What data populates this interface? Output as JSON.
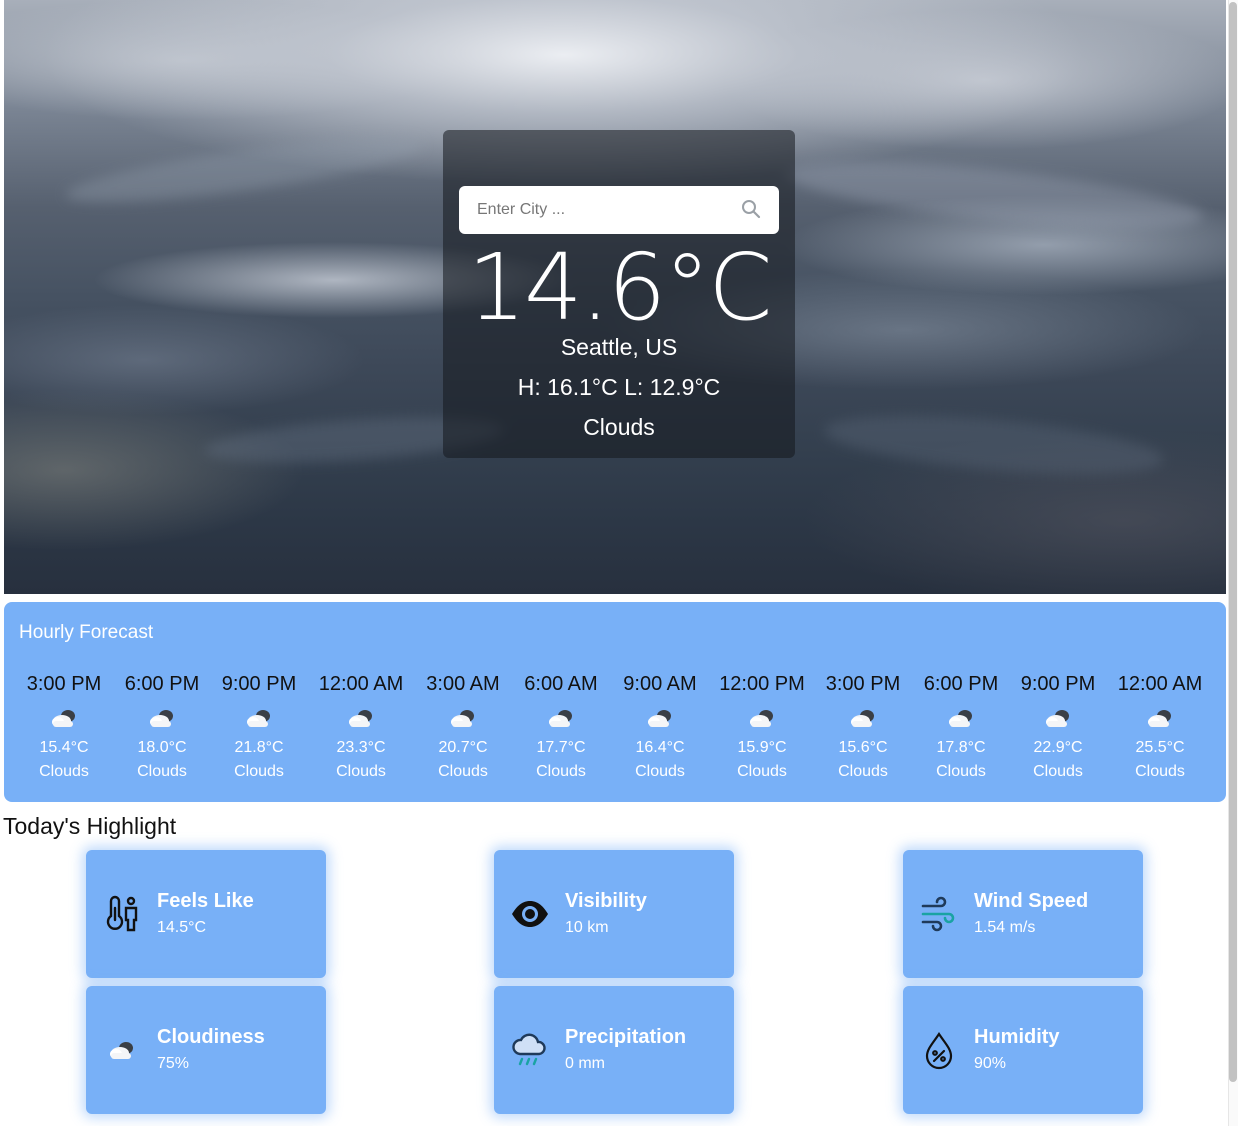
{
  "search": {
    "placeholder": "Enter City ..."
  },
  "current": {
    "temperature": "14.6°C",
    "location": "Seattle, US",
    "high_low": "H: 16.1°C L: 12.9°C",
    "condition": "Clouds"
  },
  "hourly": {
    "title": "Hourly Forecast",
    "items": [
      {
        "time": "3:00 PM",
        "temp": "15.4°C",
        "desc": "Clouds",
        "icon": "cloud-icon"
      },
      {
        "time": "6:00 PM",
        "temp": "18.0°C",
        "desc": "Clouds",
        "icon": "cloud-icon"
      },
      {
        "time": "9:00 PM",
        "temp": "21.8°C",
        "desc": "Clouds",
        "icon": "cloud-icon"
      },
      {
        "time": "12:00 AM",
        "temp": "23.3°C",
        "desc": "Clouds",
        "icon": "cloud-icon"
      },
      {
        "time": "3:00 AM",
        "temp": "20.7°C",
        "desc": "Clouds",
        "icon": "cloud-icon"
      },
      {
        "time": "6:00 AM",
        "temp": "17.7°C",
        "desc": "Clouds",
        "icon": "cloud-icon"
      },
      {
        "time": "9:00 AM",
        "temp": "16.4°C",
        "desc": "Clouds",
        "icon": "cloud-icon"
      },
      {
        "time": "12:00 PM",
        "temp": "15.9°C",
        "desc": "Clouds",
        "icon": "cloud-icon"
      },
      {
        "time": "3:00 PM",
        "temp": "15.6°C",
        "desc": "Clouds",
        "icon": "cloud-icon"
      },
      {
        "time": "6:00 PM",
        "temp": "17.8°C",
        "desc": "Clouds",
        "icon": "cloud-icon"
      },
      {
        "time": "9:00 PM",
        "temp": "22.9°C",
        "desc": "Clouds",
        "icon": "cloud-icon"
      },
      {
        "time": "12:00 AM",
        "temp": "25.5°C",
        "desc": "Clouds",
        "icon": "cloud-icon"
      }
    ]
  },
  "highlights": {
    "title": "Today's Highlight",
    "items": [
      {
        "label": "Feels Like",
        "value": "14.5°C",
        "icon": "thermometer-person-icon"
      },
      {
        "label": "Visibility",
        "value": "10 km",
        "icon": "eye-icon"
      },
      {
        "label": "Wind Speed",
        "value": "1.54 m/s",
        "icon": "wind-icon"
      },
      {
        "label": "Cloudiness",
        "value": "75%",
        "icon": "cloud-icon"
      },
      {
        "label": "Precipitation",
        "value": "0 mm",
        "icon": "rain-cloud-icon"
      },
      {
        "label": "Humidity",
        "value": "90%",
        "icon": "humidity-drop-icon"
      }
    ]
  },
  "colors": {
    "accent": "#78b0f7",
    "card_overlay": "#14181e"
  }
}
